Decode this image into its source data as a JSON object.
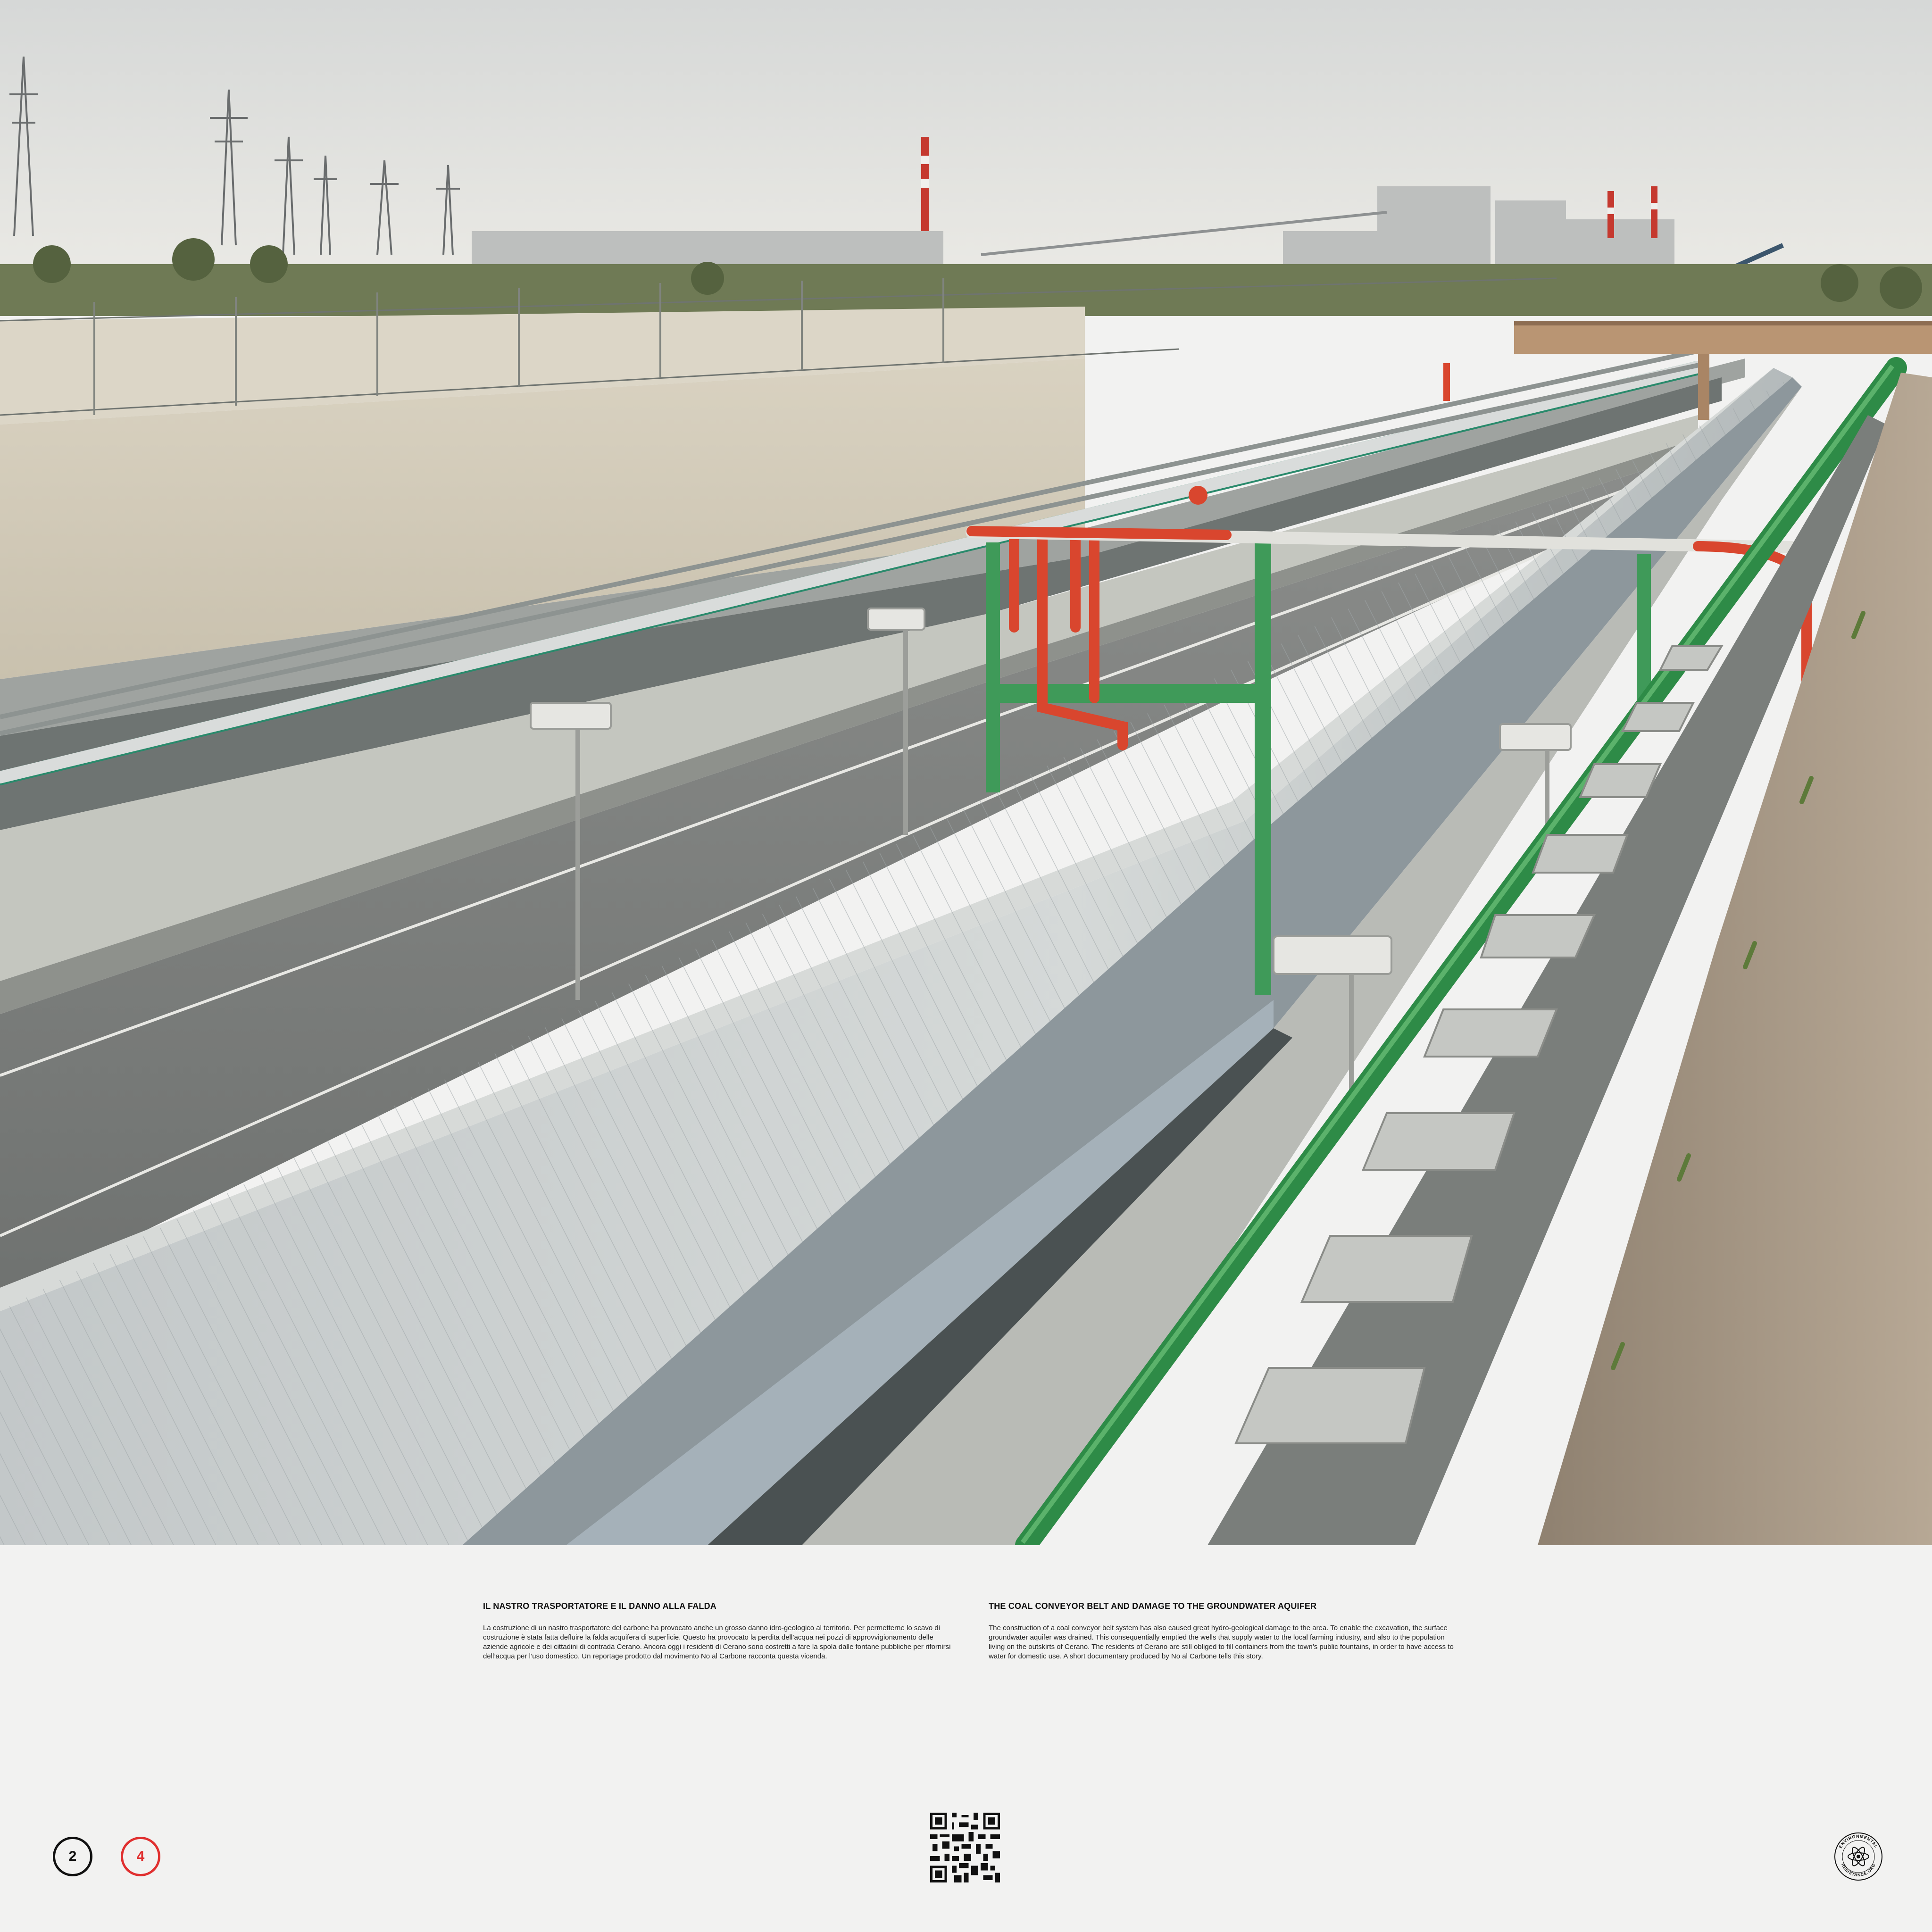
{
  "photo": {
    "subject": "coal-conveyor-belt-trench"
  },
  "captions": {
    "italian": {
      "title": "IL NASTRO TRASPORTATORE E IL DANNO ALLA FALDA",
      "body": "La costruzione di un nastro trasportatore del carbone ha provocato anche un grosso danno idro-geologico al territorio. Per permetterne lo scavo di costruzione è stata fatta defluire la falda acquifera di superficie. Questo ha provocato la perdita dell’acqua nei pozzi di approvvigionamento delle aziende agricole e dei cittadini di contrada Cerano.  Ancora oggi i residenti di Cerano sono costretti a fare la spola dalle fontane pubbliche per rifornirsi dell’acqua per l’uso domestico. Un reportage prodotto dal movimento No al Carbone racconta questa vicenda."
    },
    "english": {
      "title": "THE COAL CONVEYOR BELT AND DAMAGE TO THE GROUNDWATER AQUIFER",
      "body": "The construction of a coal conveyor belt system has also caused great hydro-geological damage to the area. To enable the excavation, the surface groundwater aquifer was drained. This consequentially emptied the wells that supply water to the local farming industry, and also to the population living on the outskirts of Cerano. The residents of Cerano are still obliged to fill containers from the town’s public fountains, in order to have access to water for domestic use. A short documentary produced by No al Carbone tells this story."
    }
  },
  "pagination": {
    "current": "2",
    "total": "4",
    "current_color": "#111111",
    "total_color": "#e03030"
  },
  "footer": {
    "qr_icon": "qr-code-icon",
    "logo_icon": "environmental-resistance-logo",
    "logo_text_top": "ENVIRONMENTAL",
    "logo_text_bottom": "RESISTANCE.ORG"
  }
}
